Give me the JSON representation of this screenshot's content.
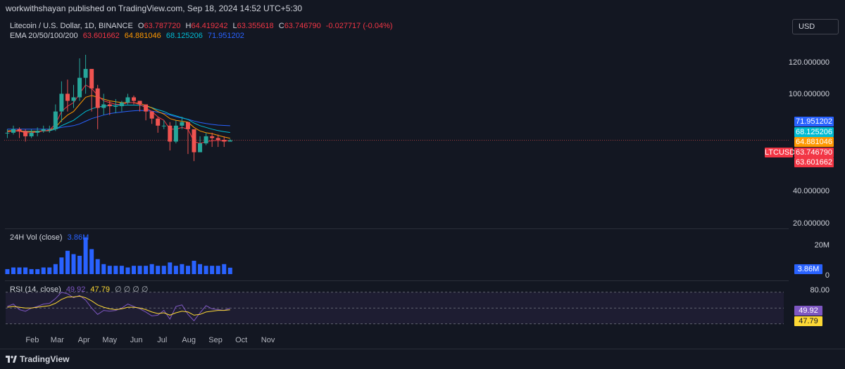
{
  "header": {
    "publisher": "workwithshayan published on TradingView.com, Sep 18, 2024 14:52 UTC+5:30"
  },
  "legend": {
    "symbol": "Litecoin / U.S. Dollar, 1D, BINANCE",
    "o_label": "O",
    "o_value": "63.787720",
    "h_label": "H",
    "h_value": "64.419242",
    "l_label": "L",
    "l_value": "63.355618",
    "c_label": "C",
    "c_value": "63.746790",
    "change": "-0.027717 (-0.04%)",
    "ema_label": "EMA 20/50/100/200",
    "ema20": "63.601662",
    "ema50": "64.881046",
    "ema100": "68.125206",
    "ema200": "71.951202",
    "vol_label": "24H Vol (close)",
    "vol_value": "3.86M",
    "rsi_label": "RSI (14, close)",
    "rsi_value": "49.92",
    "rsi_ma_value": "47.79",
    "hidden_marks": "∅ ∅ ∅ ∅"
  },
  "currency": "USD",
  "price_axis": [
    "120.000000",
    "100.000000",
    "40.000000",
    "20.000000"
  ],
  "price_badges": {
    "ema200": "71.951202",
    "ema100": "68.125206",
    "ema50": "64.881046",
    "symbol_tag": "LTCUSD",
    "last": "63.746790",
    "ema20": "63.601662"
  },
  "volume_axis": {
    "top": "20M",
    "zero": "0",
    "badge": "3.86M"
  },
  "rsi_axis": {
    "top": "80.00",
    "rsi": "49.92",
    "rsi_ma": "47.79"
  },
  "time_axis": [
    "Feb",
    "Mar",
    "Apr",
    "May",
    "Jun",
    "Jul",
    "Aug",
    "Sep",
    "Oct",
    "Nov"
  ],
  "brand": "TradingView",
  "colors": {
    "up": "#26a69a",
    "down": "#ef5350",
    "ema20": "#f23645",
    "ema50": "#ff9800",
    "ema100": "#00bcd4",
    "ema200": "#2962ff",
    "volume": "#2962ff",
    "rsi": "#7e57c2",
    "rsi_ma": "#fdd835"
  },
  "chart_data": {
    "type": "candlestick",
    "title": "Litecoin / U.S. Dollar, 1D, BINANCE",
    "x": [
      "2024-01-03",
      "2024-01-10",
      "2024-01-17",
      "2024-01-24",
      "2024-01-31",
      "2024-02-07",
      "2024-02-14",
      "2024-02-21",
      "2024-02-28",
      "2024-03-06",
      "2024-03-13",
      "2024-03-20",
      "2024-03-27",
      "2024-04-03",
      "2024-04-10",
      "2024-04-17",
      "2024-04-24",
      "2024-05-01",
      "2024-05-08",
      "2024-05-15",
      "2024-05-22",
      "2024-05-29",
      "2024-06-05",
      "2024-06-12",
      "2024-06-19",
      "2024-06-26",
      "2024-07-03",
      "2024-07-10",
      "2024-07-17",
      "2024-07-24",
      "2024-07-31",
      "2024-08-07",
      "2024-08-14",
      "2024-08-21",
      "2024-08-28",
      "2024-09-04",
      "2024-09-11",
      "2024-09-18"
    ],
    "close": [
      68,
      70,
      69,
      66,
      68,
      69,
      70,
      70,
      80,
      90,
      86,
      88,
      99,
      104,
      93,
      82,
      84,
      83,
      83,
      85,
      88,
      86,
      84,
      80,
      76,
      72,
      72,
      63,
      72,
      74,
      70,
      57,
      62,
      66,
      65,
      64,
      63,
      63.75
    ],
    "high": [
      70,
      72,
      71,
      70,
      70,
      71,
      72,
      72,
      84,
      97,
      98,
      95,
      110,
      112,
      100,
      95,
      90,
      86,
      87,
      86,
      90,
      89,
      86,
      83,
      79,
      77,
      75,
      74,
      75,
      77,
      74,
      66,
      66,
      68,
      68,
      67,
      66,
      64.42
    ],
    "low": [
      65,
      67,
      65,
      63,
      65,
      66,
      68,
      68,
      69,
      74,
      80,
      82,
      86,
      90,
      80,
      70,
      78,
      78,
      79,
      80,
      84,
      84,
      80,
      75,
      73,
      68,
      70,
      58,
      62,
      70,
      56,
      52,
      58,
      61,
      60,
      60,
      60,
      63.36
    ],
    "ema20": [
      68.5,
      69,
      68.8,
      68,
      68,
      68.5,
      69,
      69.5,
      73,
      80,
      83,
      85,
      90,
      95,
      93,
      89,
      86,
      85,
      84,
      84,
      85,
      85,
      84,
      82,
      80,
      77,
      75,
      70,
      70,
      71,
      70,
      63,
      62,
      63,
      63.5,
      63.7,
      63.5,
      63.6
    ],
    "ema50": [
      69,
      69.2,
      69,
      68.7,
      68.6,
      68.8,
      69,
      69.3,
      71,
      75,
      78,
      80,
      84,
      88,
      89,
      88,
      87,
      86,
      85.5,
      85,
      85,
      85,
      84.5,
      83.5,
      82,
      80,
      78.5,
      76,
      75,
      74.5,
      74,
      71,
      69,
      68,
      67.5,
      66.5,
      65.6,
      64.88
    ],
    "ema100": [
      69,
      69.1,
      69,
      68.9,
      68.8,
      68.9,
      69,
      69.1,
      70,
      72,
      73.5,
      75,
      77.5,
      80,
      81.5,
      82.5,
      83,
      83.3,
      83.4,
      83.5,
      83.6,
      83.6,
      83.5,
      83,
      82.2,
      81,
      80,
      78.5,
      77.5,
      76.5,
      75.5,
      73.5,
      72,
      71,
      70,
      69.2,
      68.6,
      68.13
    ],
    "ema200": [
      70,
      70,
      70,
      70,
      70,
      70,
      70,
      70,
      70.3,
      71,
      71.5,
      72,
      73,
      74.5,
      76,
      77,
      78,
      78.8,
      79.3,
      79.7,
      80.1,
      80.4,
      80.6,
      80.5,
      80.2,
      79.6,
      79,
      78,
      77,
      76.3,
      75.6,
      74.6,
      73.8,
      73.2,
      72.7,
      72.3,
      72.1,
      71.95
    ],
    "volume_m": [
      3,
      4,
      4,
      4,
      3,
      3,
      4,
      4,
      6,
      10,
      14,
      12,
      11,
      22,
      15,
      9,
      6,
      5,
      5,
      5,
      4,
      5,
      5,
      5,
      6,
      5,
      5,
      7,
      5,
      6,
      5,
      8,
      6,
      5,
      5,
      5,
      6,
      3.86
    ],
    "rsi": [
      52,
      55,
      48,
      46,
      50,
      52,
      55,
      56,
      62,
      70,
      68,
      63,
      66,
      60,
      50,
      42,
      47,
      46,
      47,
      50,
      55,
      52,
      49,
      45,
      40,
      41,
      47,
      36,
      52,
      54,
      42,
      34,
      44,
      53,
      49,
      48,
      47,
      49.92
    ],
    "rsi_ma": [
      51,
      52,
      51,
      50,
      50,
      51,
      52,
      53,
      56,
      61,
      64,
      64,
      65,
      63,
      59,
      54,
      51,
      49,
      48,
      49,
      51,
      51,
      50,
      48,
      45,
      43,
      44,
      41,
      44,
      46,
      45,
      41,
      42,
      45,
      46,
      47,
      47,
      47.79
    ],
    "price_axis_ticks": [
      20,
      40,
      100,
      120
    ],
    "volume_axis_ticks": [
      "0",
      "20M"
    ],
    "rsi_axis_ticks": [
      80
    ],
    "ylim": [
      14,
      133
    ],
    "rsi_ylim": [
      20,
      84
    ],
    "volume_ylim_m": [
      0,
      27
    ],
    "grid": false,
    "legend": "top-left"
  }
}
